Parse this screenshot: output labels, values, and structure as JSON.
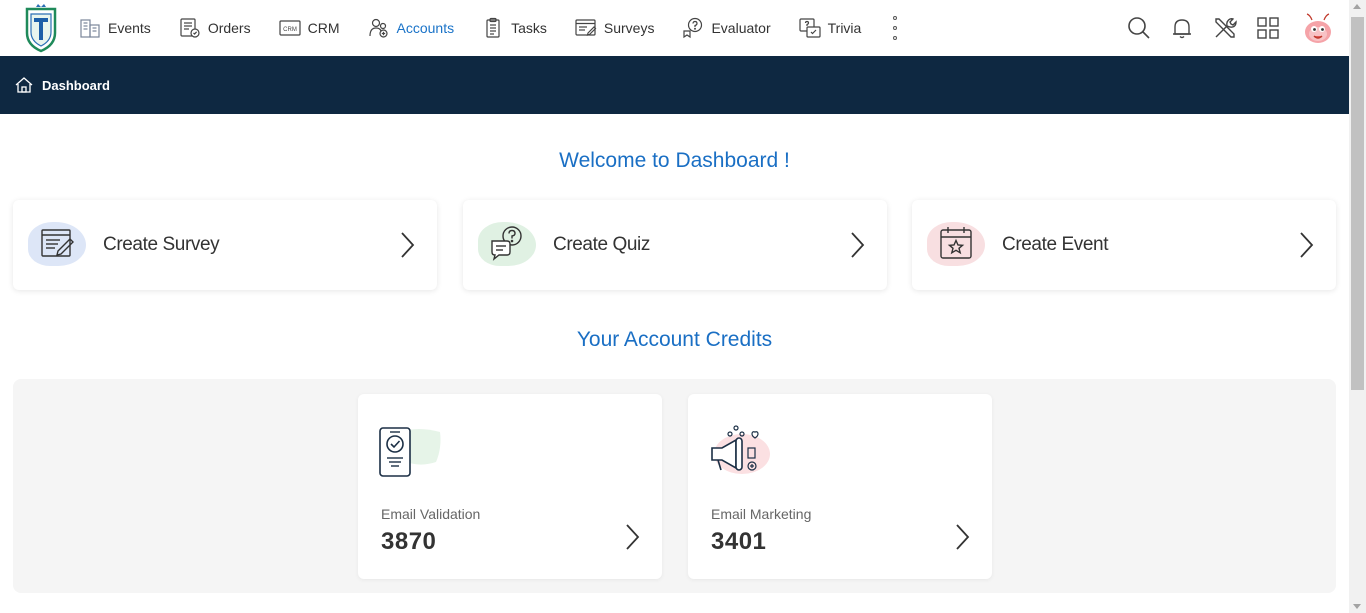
{
  "nav": {
    "items": [
      {
        "label": "Events",
        "icon": "building-icon",
        "active": false
      },
      {
        "label": "Orders",
        "icon": "orders-icon",
        "active": false
      },
      {
        "label": "CRM",
        "icon": "crm-icon",
        "active": false
      },
      {
        "label": "Accounts",
        "icon": "accounts-icon",
        "active": true
      },
      {
        "label": "Tasks",
        "icon": "tasks-icon",
        "active": false
      },
      {
        "label": "Surveys",
        "icon": "surveys-icon",
        "active": false
      },
      {
        "label": "Evaluator",
        "icon": "evaluator-icon",
        "active": false
      },
      {
        "label": "Trivia",
        "icon": "trivia-icon",
        "active": false
      }
    ],
    "crm_icon_text": "CRM",
    "right_icons": [
      "search-icon",
      "bell-icon",
      "tools-icon",
      "apps-grid-icon"
    ],
    "active_color": "#1a73c8"
  },
  "breadcrumb": {
    "label": "Dashboard",
    "bar_color": "#0e2841"
  },
  "welcome": {
    "title": "Welcome to Dashboard !"
  },
  "actions": [
    {
      "label": "Create Survey",
      "icon": "survey-form-icon",
      "blob_color": "#dde6f7"
    },
    {
      "label": "Create Quiz",
      "icon": "quiz-chat-icon",
      "blob_color": "#e0f1e3"
    },
    {
      "label": "Create Event",
      "icon": "calendar-star-icon",
      "blob_color": "#f8dfe1"
    }
  ],
  "credits": {
    "title": "Your Account Credits",
    "items": [
      {
        "label": "Email Validation",
        "value": "3870",
        "icon": "phone-check-icon"
      },
      {
        "label": "Email Marketing",
        "value": "3401",
        "icon": "megaphone-icon"
      }
    ]
  },
  "colors": {
    "heading": "#1a6fc4",
    "credits_bg": "#f5f5f5"
  }
}
